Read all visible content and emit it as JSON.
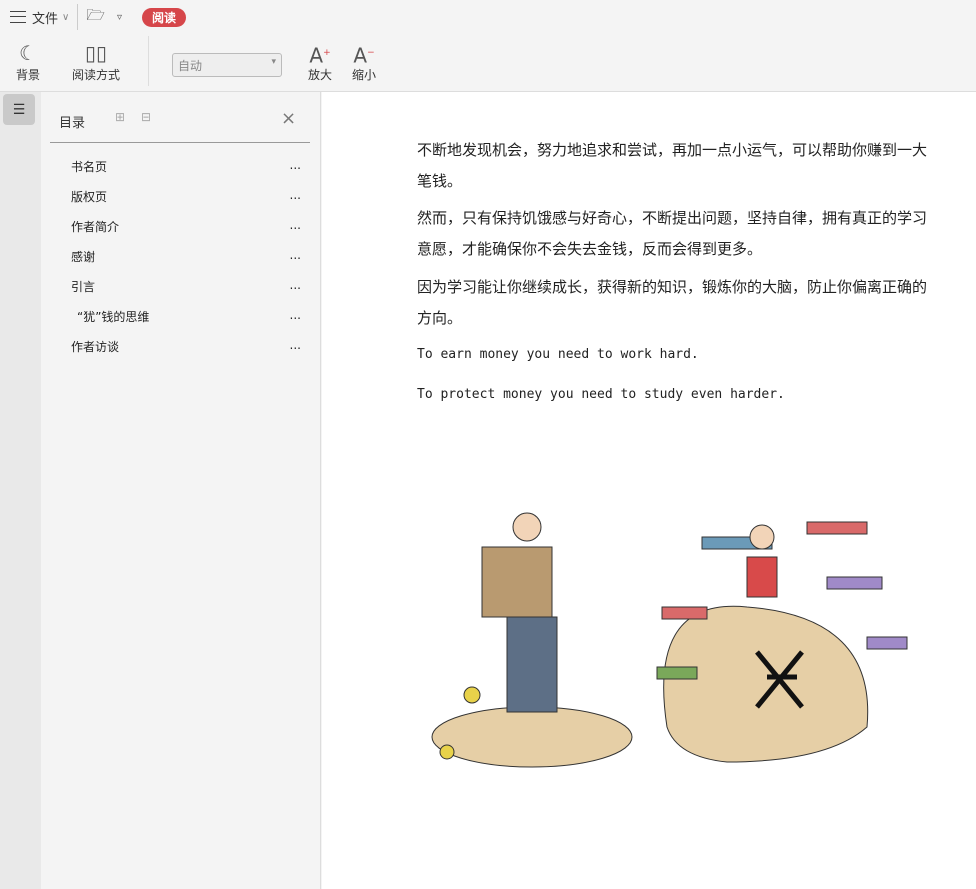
{
  "toolbar": {
    "file": "文件",
    "read_tab": "阅读",
    "background": "背景",
    "read_mode": "阅读方式",
    "auto": "自动",
    "zoom_in": "放大",
    "zoom_out": "缩小"
  },
  "toc": {
    "title": "目录",
    "items": [
      {
        "label": "书名页",
        "more": "..."
      },
      {
        "label": "版权页",
        "more": "..."
      },
      {
        "label": "作者简介",
        "more": "..."
      },
      {
        "label": "感谢",
        "more": "..."
      },
      {
        "label": "引言",
        "more": "..."
      },
      {
        "label": "“犹”钱的思维",
        "more": "..."
      },
      {
        "label": "作者访谈",
        "more": "..."
      }
    ]
  },
  "content": {
    "p1": "不断地发现机会，努力地追求和尝试，再加一点小运气，可以帮助你赚到一大笔钱。",
    "p2": "然而，只有保持饥饿感与好奇心，不断提出问题，坚持自律，拥有真正的学习意愿，才能确保你不会失去金钱，反而会得到更多。",
    "p3": "因为学习能让你继续成长，获得新的知识，锻炼你的大脑，防止你偏离正确的方向。",
    "en1": "To earn money you need to work hard.",
    "en2": "To protect money you need to study even harder."
  }
}
